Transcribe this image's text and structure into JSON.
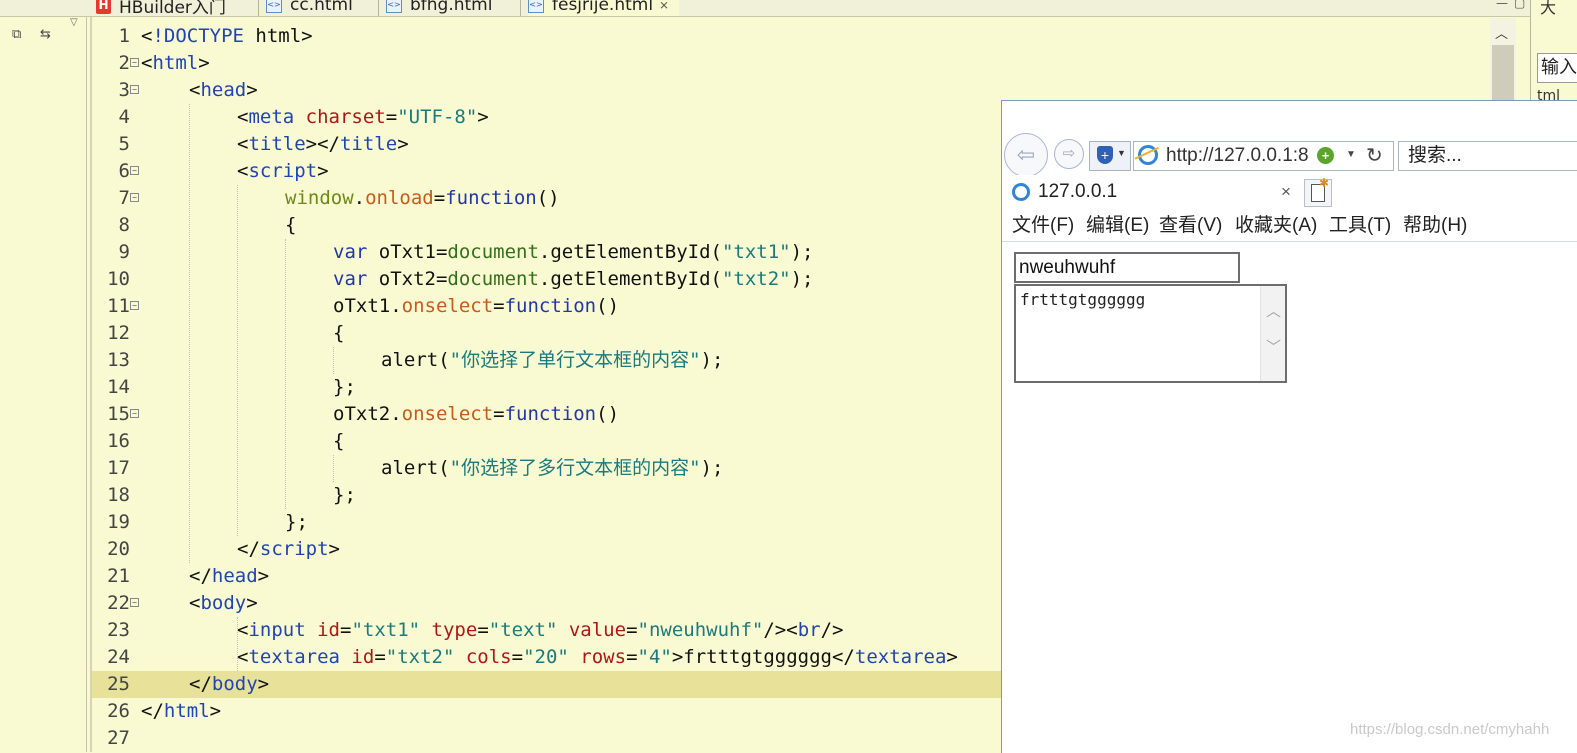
{
  "editor": {
    "tabs": [
      {
        "label": "HBuilder入门",
        "icon": "hbuilder-icon"
      },
      {
        "label": "cc.html",
        "icon": "html-file-icon"
      },
      {
        "label": "bfhg.html",
        "icon": "html-file-icon"
      },
      {
        "label": "fesjrije.html",
        "icon": "html-file-icon",
        "active": true
      }
    ],
    "current_line": 25,
    "lines": [
      {
        "n": "1",
        "fold": false,
        "indent": 0,
        "tokens": [
          [
            "pl",
            "<"
          ],
          [
            "tag",
            "!DOCTYPE"
          ],
          [
            "pl",
            " html>"
          ]
        ]
      },
      {
        "n": "2",
        "fold": true,
        "indent": 0,
        "tokens": [
          [
            "pl",
            "<"
          ],
          [
            "tag",
            "html"
          ],
          [
            "pl",
            ">"
          ]
        ]
      },
      {
        "n": "3",
        "fold": true,
        "indent": 1,
        "tokens": [
          [
            "pl",
            "<"
          ],
          [
            "tag",
            "head"
          ],
          [
            "pl",
            ">"
          ]
        ]
      },
      {
        "n": "4",
        "fold": false,
        "indent": 2,
        "tokens": [
          [
            "pl",
            "<"
          ],
          [
            "tag",
            "meta"
          ],
          [
            "pl",
            " "
          ],
          [
            "attr",
            "charset"
          ],
          [
            "pl",
            "="
          ],
          [
            "str",
            "\"UTF-8\""
          ],
          [
            "pl",
            ">"
          ]
        ]
      },
      {
        "n": "5",
        "fold": false,
        "indent": 2,
        "tokens": [
          [
            "pl",
            "<"
          ],
          [
            "tag",
            "title"
          ],
          [
            "pl",
            "></"
          ],
          [
            "tag",
            "title"
          ],
          [
            "pl",
            ">"
          ]
        ]
      },
      {
        "n": "6",
        "fold": true,
        "indent": 2,
        "tokens": [
          [
            "pl",
            "<"
          ],
          [
            "tag",
            "script"
          ],
          [
            "pl",
            ">"
          ]
        ]
      },
      {
        "n": "7",
        "fold": true,
        "indent": 3,
        "tokens": [
          [
            "id",
            "window"
          ],
          [
            "pl",
            "."
          ],
          [
            "prop",
            "onload"
          ],
          [
            "pl",
            "="
          ],
          [
            "kw",
            "function"
          ],
          [
            "pl",
            "()"
          ]
        ]
      },
      {
        "n": "8",
        "fold": false,
        "indent": 3,
        "tokens": [
          [
            "pl",
            "{"
          ]
        ]
      },
      {
        "n": "9",
        "fold": false,
        "indent": 4,
        "tokens": [
          [
            "kw",
            "var"
          ],
          [
            "pl",
            " oTxt1="
          ],
          [
            "fn",
            "document"
          ],
          [
            "pl",
            ".getElementById("
          ],
          [
            "str",
            "\"txt1\""
          ],
          [
            "pl",
            ");"
          ]
        ]
      },
      {
        "n": "10",
        "fold": false,
        "indent": 4,
        "tokens": [
          [
            "kw",
            "var"
          ],
          [
            "pl",
            " oTxt2="
          ],
          [
            "fn",
            "document"
          ],
          [
            "pl",
            ".getElementById("
          ],
          [
            "str",
            "\"txt2\""
          ],
          [
            "pl",
            ");"
          ]
        ]
      },
      {
        "n": "11",
        "fold": true,
        "indent": 4,
        "tokens": [
          [
            "pl",
            "oTxt1."
          ],
          [
            "prop",
            "onselect"
          ],
          [
            "pl",
            "="
          ],
          [
            "kw",
            "function"
          ],
          [
            "pl",
            "()"
          ]
        ]
      },
      {
        "n": "12",
        "fold": false,
        "indent": 4,
        "tokens": [
          [
            "pl",
            "{"
          ]
        ]
      },
      {
        "n": "13",
        "fold": false,
        "indent": 5,
        "tokens": [
          [
            "pl",
            "alert("
          ],
          [
            "str",
            "\"你选择了单行文本框的内容\""
          ],
          [
            "pl",
            ");"
          ]
        ]
      },
      {
        "n": "14",
        "fold": false,
        "indent": 4,
        "tokens": [
          [
            "pl",
            "};"
          ]
        ]
      },
      {
        "n": "15",
        "fold": true,
        "indent": 4,
        "tokens": [
          [
            "pl",
            "oTxt2."
          ],
          [
            "prop",
            "onselect"
          ],
          [
            "pl",
            "="
          ],
          [
            "kw",
            "function"
          ],
          [
            "pl",
            "()"
          ]
        ]
      },
      {
        "n": "16",
        "fold": false,
        "indent": 4,
        "tokens": [
          [
            "pl",
            "{"
          ]
        ]
      },
      {
        "n": "17",
        "fold": false,
        "indent": 5,
        "tokens": [
          [
            "pl",
            "alert("
          ],
          [
            "str",
            "\"你选择了多行文本框的内容\""
          ],
          [
            "pl",
            ");"
          ]
        ]
      },
      {
        "n": "18",
        "fold": false,
        "indent": 4,
        "tokens": [
          [
            "pl",
            "};"
          ]
        ]
      },
      {
        "n": "19",
        "fold": false,
        "indent": 3,
        "tokens": [
          [
            "pl",
            "};"
          ]
        ]
      },
      {
        "n": "20",
        "fold": false,
        "indent": 2,
        "tokens": [
          [
            "pl",
            "</"
          ],
          [
            "tag",
            "script"
          ],
          [
            "pl",
            ">"
          ]
        ]
      },
      {
        "n": "21",
        "fold": false,
        "indent": 1,
        "tokens": [
          [
            "pl",
            "</"
          ],
          [
            "tag",
            "head"
          ],
          [
            "pl",
            ">"
          ]
        ]
      },
      {
        "n": "22",
        "fold": true,
        "indent": 1,
        "tokens": [
          [
            "pl",
            "<"
          ],
          [
            "tag",
            "body"
          ],
          [
            "pl",
            ">"
          ]
        ]
      },
      {
        "n": "23",
        "fold": false,
        "indent": 2,
        "tokens": [
          [
            "pl",
            "<"
          ],
          [
            "tag",
            "input"
          ],
          [
            "pl",
            " "
          ],
          [
            "attr",
            "id"
          ],
          [
            "pl",
            "="
          ],
          [
            "str",
            "\"txt1\""
          ],
          [
            "pl",
            " "
          ],
          [
            "attr",
            "type"
          ],
          [
            "pl",
            "="
          ],
          [
            "str",
            "\"text\""
          ],
          [
            "pl",
            " "
          ],
          [
            "attr",
            "value"
          ],
          [
            "pl",
            "="
          ],
          [
            "str",
            "\"nweuhwuhf\""
          ],
          [
            "pl",
            "/><"
          ],
          [
            "tag",
            "br"
          ],
          [
            "pl",
            "/>"
          ]
        ]
      },
      {
        "n": "24",
        "fold": false,
        "indent": 2,
        "tokens": [
          [
            "pl",
            "<"
          ],
          [
            "tag",
            "textarea"
          ],
          [
            "pl",
            " "
          ],
          [
            "attr",
            "id"
          ],
          [
            "pl",
            "="
          ],
          [
            "str",
            "\"txt2\""
          ],
          [
            "pl",
            " "
          ],
          [
            "attr",
            "cols"
          ],
          [
            "pl",
            "="
          ],
          [
            "str",
            "\"20\""
          ],
          [
            "pl",
            " "
          ],
          [
            "attr",
            "rows"
          ],
          [
            "pl",
            "="
          ],
          [
            "str",
            "\"4\""
          ],
          [
            "pl",
            ">frtttgtgggggg</"
          ],
          [
            "tag",
            "textarea"
          ],
          [
            "pl",
            ">"
          ]
        ]
      },
      {
        "n": "25",
        "fold": false,
        "indent": 1,
        "tokens": [
          [
            "pl",
            "</"
          ],
          [
            "tag",
            "body"
          ],
          [
            "pl",
            ">"
          ]
        ]
      },
      {
        "n": "26",
        "fold": false,
        "indent": 0,
        "tokens": [
          [
            "pl",
            "</"
          ],
          [
            "tag",
            "html"
          ],
          [
            "pl",
            ">"
          ]
        ]
      },
      {
        "n": "27",
        "fold": false,
        "indent": 0,
        "tokens": []
      }
    ]
  },
  "right_panel": {
    "top_text": "大",
    "input_text": "输入",
    "sub_text": "tml"
  },
  "browser": {
    "address_url": "http://127.0.0.1:8",
    "search_placeholder": "搜索...",
    "tab_title": "127.0.0.1",
    "tab_close": "×",
    "menu": [
      "文件(F)",
      "编辑(E)",
      "查看(V)",
      "收藏夹(A)",
      "工具(T)",
      "帮助(H)"
    ],
    "page": {
      "txt1_value": "nweuhwuhf",
      "txt2_value": "frtttgtgggggg"
    }
  },
  "watermark": "https://blog.csdn.net/cmyhahh",
  "colors": {
    "editor_bg": "#fafad2",
    "current_line_bg": "#e8e19a",
    "tag": "#1f44b4",
    "attribute": "#b01616",
    "string": "#1a7a7e",
    "keyword": "#2137a8"
  }
}
